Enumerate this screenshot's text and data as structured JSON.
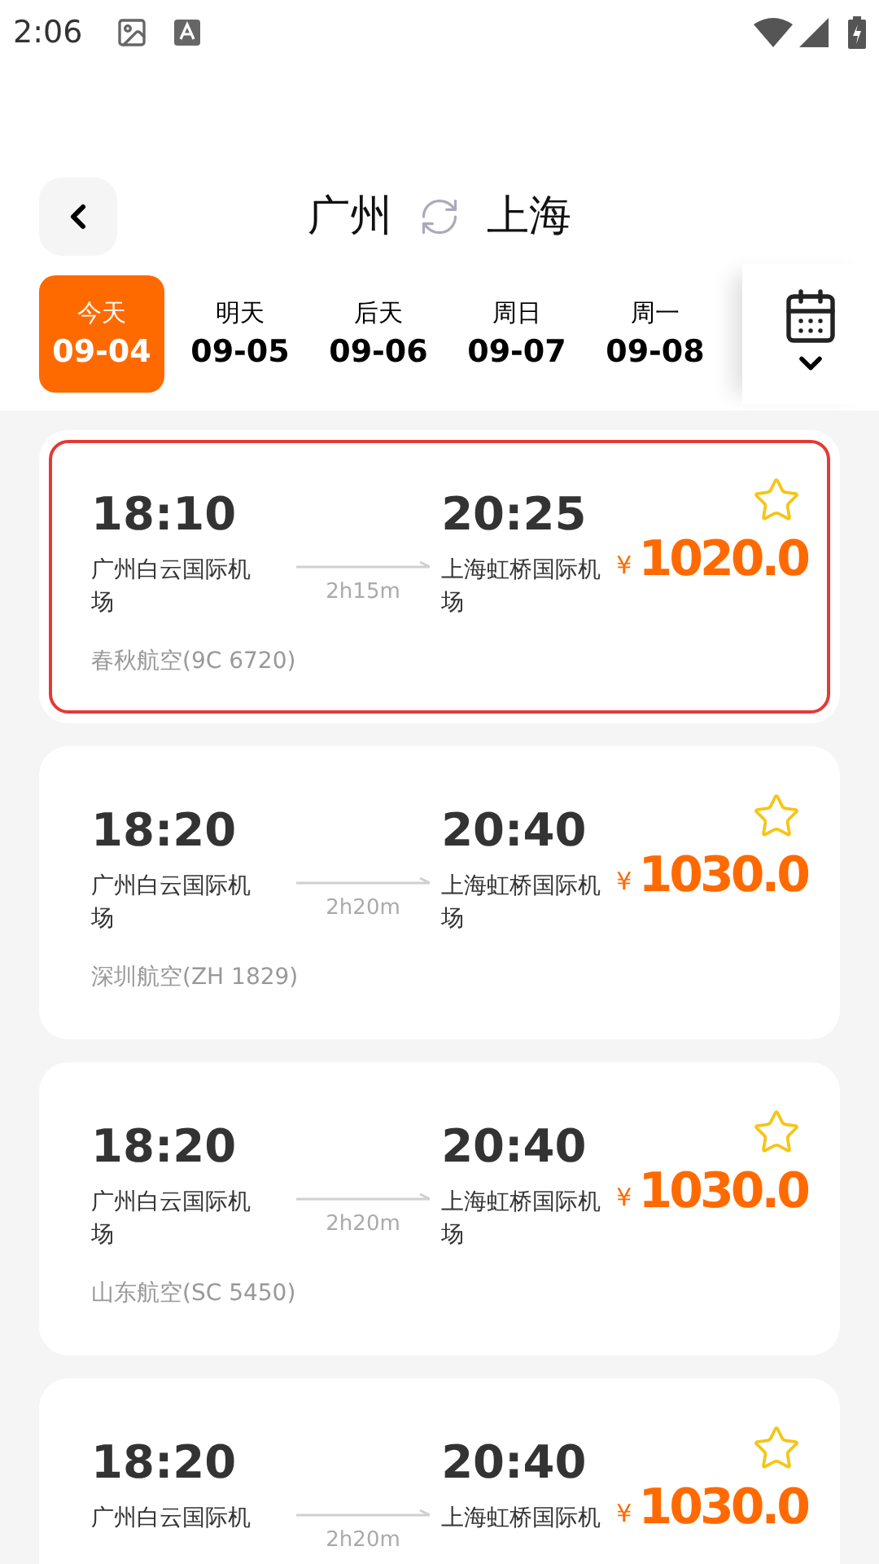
{
  "status_bar": {
    "time": "2:06"
  },
  "header": {
    "from": "广州",
    "to": "上海"
  },
  "dates": [
    {
      "day": "今天",
      "date": "09-04",
      "selected": true
    },
    {
      "day": "明天",
      "date": "09-05",
      "selected": false
    },
    {
      "day": "后天",
      "date": "09-06",
      "selected": false
    },
    {
      "day": "周日",
      "date": "09-07",
      "selected": false
    },
    {
      "day": "周一",
      "date": "09-08",
      "selected": false
    }
  ],
  "flights": [
    {
      "depart_time": "18:10",
      "depart_airport": "广州白云国际机场",
      "duration": "2h15m",
      "arrive_time": "20:25",
      "arrive_airport": "上海虹桥国际机场",
      "currency": "¥",
      "price": "1020.0",
      "airline": "春秋航空(9C 6720)",
      "highlighted": true
    },
    {
      "depart_time": "18:20",
      "depart_airport": "广州白云国际机场",
      "duration": "2h20m",
      "arrive_time": "20:40",
      "arrive_airport": "上海虹桥国际机场",
      "currency": "¥",
      "price": "1030.0",
      "airline": "深圳航空(ZH 1829)",
      "highlighted": false
    },
    {
      "depart_time": "18:20",
      "depart_airport": "广州白云国际机场",
      "duration": "2h20m",
      "arrive_time": "20:40",
      "arrive_airport": "上海虹桥国际机场",
      "currency": "¥",
      "price": "1030.0",
      "airline": "山东航空(SC 5450)",
      "highlighted": false
    },
    {
      "depart_time": "18:20",
      "depart_airport": "广州白云国际机",
      "duration": "2h20m",
      "arrive_time": "20:40",
      "arrive_airport": "上海虹桥国际机",
      "currency": "¥",
      "price": "1030.0",
      "highlighted": false
    }
  ]
}
